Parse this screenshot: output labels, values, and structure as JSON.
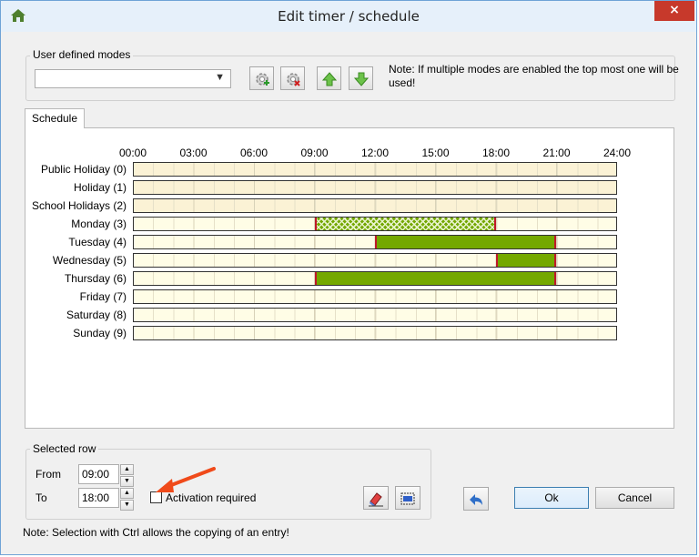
{
  "window": {
    "title": "Edit timer / schedule",
    "close_symbol": "×",
    "accent_color": "#c7392b"
  },
  "modes": {
    "group_label": "User defined modes",
    "selected_value": "",
    "buttons": [
      {
        "name": "add-mode-icon"
      },
      {
        "name": "remove-mode-icon"
      },
      {
        "name": "move-up-icon"
      },
      {
        "name": "move-down-icon"
      }
    ],
    "note": "Note: If multiple modes are enabled the top most one will be used!"
  },
  "tabs": [
    {
      "label": "Schedule"
    }
  ],
  "schedule": {
    "time_labels": [
      "00:00",
      "03:00",
      "06:00",
      "09:00",
      "12:00",
      "15:00",
      "18:00",
      "21:00",
      "24:00"
    ],
    "rows": [
      {
        "label": "Public Holiday (0)",
        "segments": []
      },
      {
        "label": "Holiday (1)",
        "segments": []
      },
      {
        "label": "School Holidays (2)",
        "segments": []
      },
      {
        "label": "Monday (3)",
        "segments": [
          {
            "start": "09:00",
            "end": "18:00",
            "style": "hatched",
            "selected": true
          }
        ]
      },
      {
        "label": "Tuesday (4)",
        "segments": [
          {
            "start": "12:00",
            "end": "21:00",
            "style": "solid"
          }
        ]
      },
      {
        "label": "Wednesday (5)",
        "segments": [
          {
            "start": "18:00",
            "end": "21:00",
            "style": "solid"
          }
        ]
      },
      {
        "label": "Thursday (6)",
        "segments": [
          {
            "start": "09:00",
            "end": "21:00",
            "style": "solid"
          }
        ]
      },
      {
        "label": "Friday (7)",
        "segments": []
      },
      {
        "label": "Saturday (8)",
        "segments": []
      },
      {
        "label": "Sunday (9)",
        "segments": []
      }
    ],
    "active_color": "#74a800",
    "empty_color": "#fffde6",
    "boundary_color": "#c0182a"
  },
  "selected_row": {
    "group_label": "Selected row",
    "from_label": "From",
    "from_value": "09:00",
    "to_label": "To",
    "to_value": "18:00",
    "activation_label": "Activation required",
    "activation_checked": false
  },
  "footer": {
    "ok_label": "Ok",
    "cancel_label": "Cancel",
    "note": "Note: Selection with Ctrl allows the copying of an entry!"
  }
}
